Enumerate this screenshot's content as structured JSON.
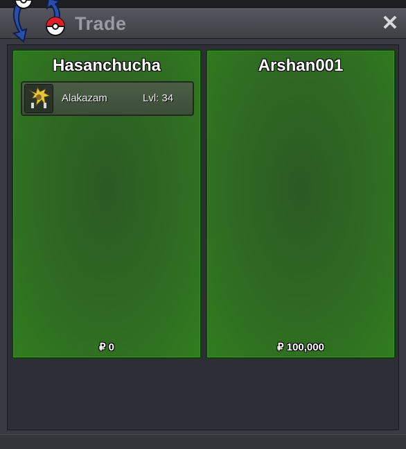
{
  "window": {
    "title": "Trade",
    "close_symbol": "✕",
    "logo_icon": "pokeball-exchange-icon"
  },
  "left_panel": {
    "player_name": "Hasanchucha",
    "money": "₽ 0",
    "items": [
      {
        "icon": "alakazam-sprite-icon",
        "name": "Alakazam",
        "level": "Lvl: 34"
      }
    ]
  },
  "right_panel": {
    "player_name": "Arshan001",
    "money": "₽ 100,000",
    "items": []
  },
  "colors": {
    "panel_green": "#2f6a22",
    "panel_border": "#0f3d0a",
    "window_bg": "#3a3a42"
  }
}
